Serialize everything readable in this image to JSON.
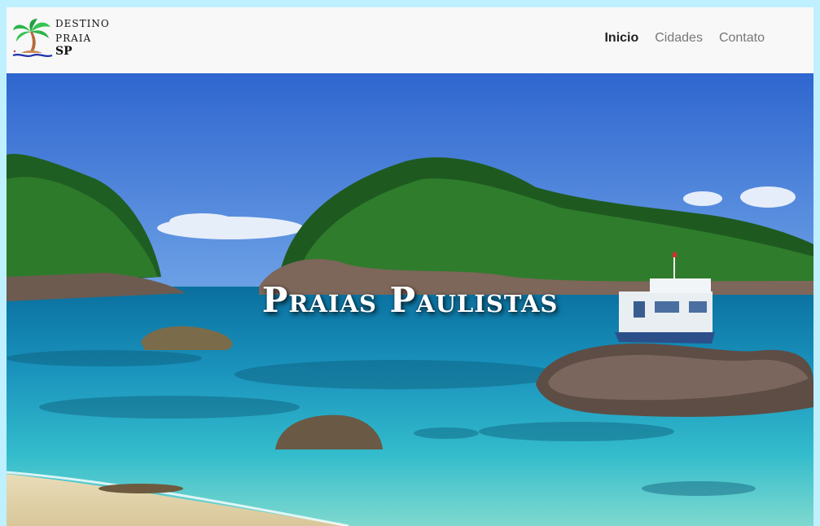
{
  "brand": {
    "line1": "DESTINO",
    "line2": "PRAIA",
    "line3": "SP"
  },
  "nav": {
    "items": [
      {
        "label": "Inicio",
        "active": true
      },
      {
        "label": "Cidades",
        "active": false
      },
      {
        "label": "Contato",
        "active": false
      }
    ]
  },
  "hero": {
    "title": "Praias Paulistas"
  },
  "colors": {
    "page_background": "#bff0ff",
    "navbar_background": "#f8f8f8",
    "nav_active": "#222222",
    "nav_inactive": "#777777",
    "sky": "#3f78d8",
    "sea": "#1aa5c4"
  }
}
